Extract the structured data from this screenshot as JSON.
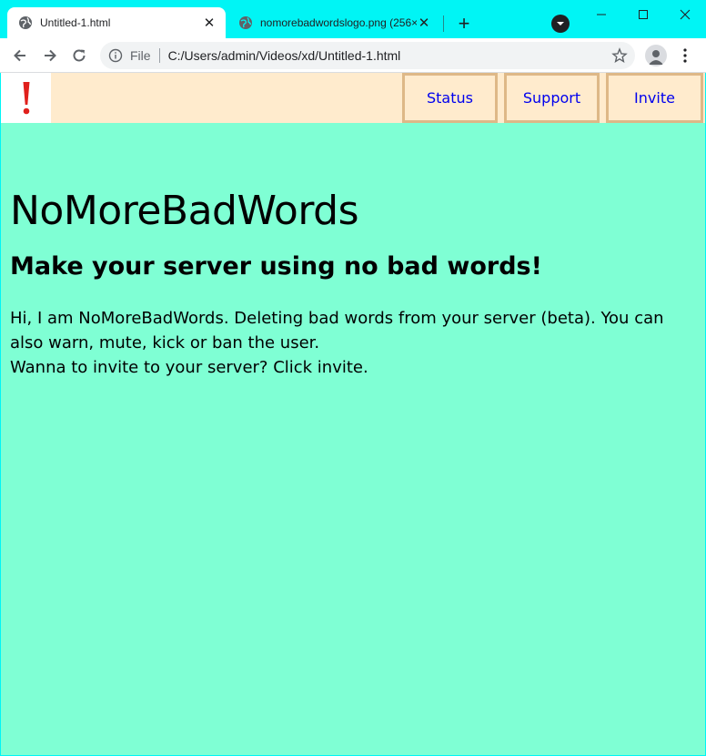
{
  "browser": {
    "tabs": [
      {
        "title": "Untitled-1.html",
        "active": true
      },
      {
        "title": "nomorebadwordslogo.png (256×",
        "active": false
      }
    ],
    "address": {
      "scheme_label": "File",
      "url": "C:/Users/admin/Videos/xd/Untitled-1.html"
    }
  },
  "page": {
    "logo_glyph": "!",
    "nav": {
      "status": "Status",
      "support": "Support",
      "invite": "Invite"
    },
    "heading": "NoMoreBadWords",
    "subheading": "Make your server using no bad words!",
    "description": "Hi, I am NoMoreBadWords. Deleting bad words from your server (beta). You can also warn, mute, kick or ban the user.",
    "invite_prompt": "Wanna to invite to your server? Click invite."
  },
  "colors": {
    "window_frame": "#00f5f5",
    "page_background": "#7fffd4",
    "navbar_background": "#ffebcd",
    "nav_border": "#deb887",
    "link": "#0000ee",
    "logo": "#e0201c"
  }
}
